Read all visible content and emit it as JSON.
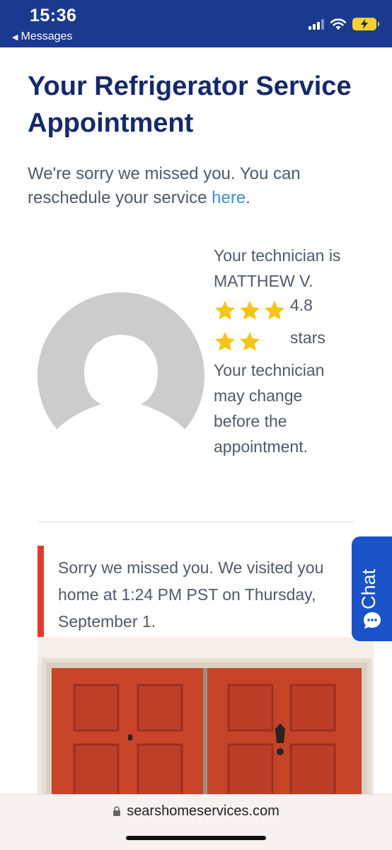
{
  "status_bar": {
    "time": "15:36",
    "back_label": "Messages",
    "icons": [
      "cellular-signal-icon",
      "wifi-icon",
      "battery-charging-icon"
    ],
    "background": "#1b3a8f"
  },
  "page": {
    "title": "Your Refrigerator Service Appointment",
    "missed_message": "We're sorry we missed you. You can reschedule your service ",
    "missed_link": "here",
    "missed_period": "."
  },
  "technician": {
    "intro": "Your technician is MATTHEW V.",
    "rating_value": "4.8",
    "rating_unit": "stars",
    "rating_stars": 5,
    "change_note": "Your technician may change before the appointment.",
    "avatar_icon": "default-user-avatar-icon"
  },
  "visit_notice": {
    "lines": [
      "Sorry we missed you. We visited you",
      "home at 1:24 PM PST on Thursday,",
      "September 1."
    ],
    "accent": "#e63a2e"
  },
  "chat_tab": {
    "label": "Chat",
    "icon": "chat-bubble-icon",
    "background": "#1a52c8"
  },
  "browser": {
    "url": "searshomeservices.com",
    "icon": "lock-icon"
  },
  "colors": {
    "title": "#15296b",
    "link": "#3d8fd6",
    "star": "#f5c518",
    "door": "#c8452a"
  }
}
